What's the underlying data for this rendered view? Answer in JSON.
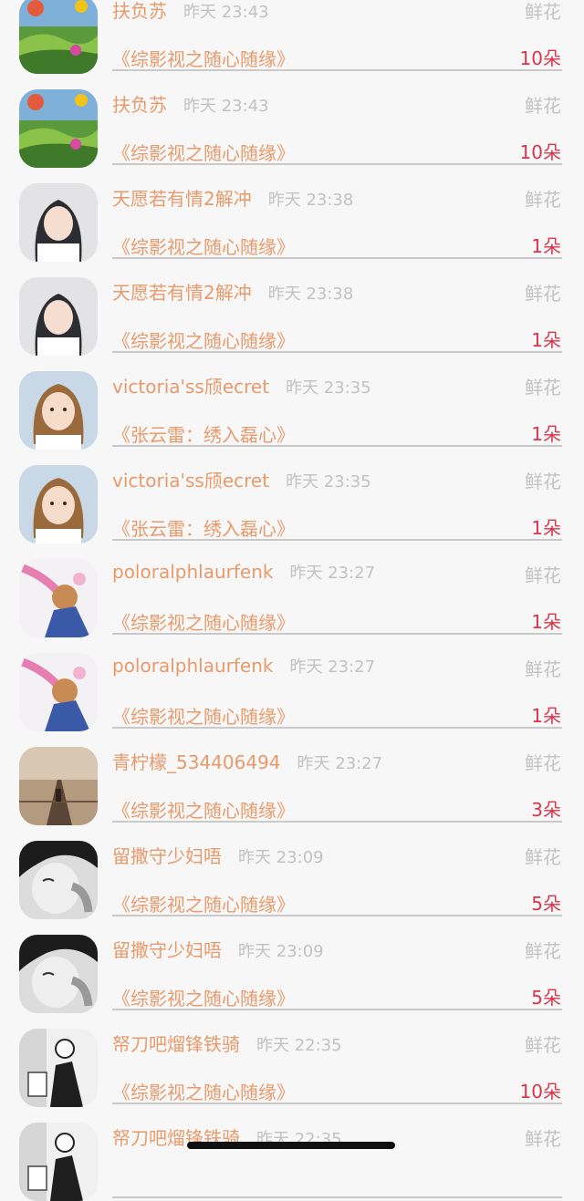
{
  "messages": [
    {
      "name": "扶负苏",
      "time": "昨天 23:43",
      "gift": "鲜花",
      "book": "《综影视之随心随缘》",
      "count": "10朵",
      "avatar": "landscape-balloon-avatar"
    },
    {
      "name": "扶负苏",
      "time": "昨天 23:43",
      "gift": "鲜花",
      "book": "《综影视之随心随缘》",
      "count": "10朵",
      "avatar": "landscape-balloon-avatar"
    },
    {
      "name": "天愿若有情2解冲",
      "time": "昨天 23:38",
      "gift": "鲜花",
      "book": "《综影视之随心随缘》",
      "count": "1朵",
      "avatar": "girl-portrait-avatar"
    },
    {
      "name": "天愿若有情2解冲",
      "time": "昨天 23:38",
      "gift": "鲜花",
      "book": "《综影视之随心随缘》",
      "count": "1朵",
      "avatar": "girl-portrait-avatar"
    },
    {
      "name": "victoria'ss颀ecret",
      "time": "昨天 23:35",
      "gift": "鲜花",
      "book": "《张云雷：绣入磊心》",
      "count": "1朵",
      "avatar": "child-portrait-avatar"
    },
    {
      "name": "victoria'ss颀ecret",
      "time": "昨天 23:35",
      "gift": "鲜花",
      "book": "《张云雷：绣入磊心》",
      "count": "1朵",
      "avatar": "child-portrait-avatar"
    },
    {
      "name": "poloralphlaurfenk",
      "time": "昨天 23:27",
      "gift": "鲜花",
      "book": "《综影视之随心随缘》",
      "count": "1朵",
      "avatar": "anime-illustration-avatar"
    },
    {
      "name": "poloralphlaurfenk",
      "time": "昨天 23:27",
      "gift": "鲜花",
      "book": "《综影视之随心随缘》",
      "count": "1朵",
      "avatar": "anime-illustration-avatar"
    },
    {
      "name": "青柠檬_534406494",
      "time": "昨天 23:27",
      "gift": "鲜花",
      "book": "《综影视之随心随缘》",
      "count": "3朵",
      "avatar": "railway-scene-avatar"
    },
    {
      "name": "留撒守少妇唔",
      "time": "昨天 23:09",
      "gift": "鲜花",
      "book": "《综影视之随心随缘》",
      "count": "5朵",
      "avatar": "crying-face-avatar"
    },
    {
      "name": "留撒守少妇唔",
      "time": "昨天 23:09",
      "gift": "鲜花",
      "book": "《综影视之随心随缘》",
      "count": "5朵",
      "avatar": "crying-face-avatar"
    },
    {
      "name": "帑刀吧熘锋铁骑",
      "time": "昨天 22:35",
      "gift": "鲜花",
      "book": "《综影视之随心随缘》",
      "count": "10朵",
      "avatar": "sketch-figure-avatar"
    },
    {
      "name": "帑刀吧熘锋铁骑",
      "time": "昨天 22:35",
      "gift": "鲜花",
      "book": "",
      "count": "",
      "avatar": "sketch-figure-avatar"
    }
  ],
  "colors": {
    "background": "#f7f7f7",
    "name_text": "#e89a6b",
    "book_text": "#e89a6b",
    "muted_text": "#c2c2c2",
    "count_text": "#d9354b",
    "divider": "#c9c9c9",
    "home_indicator": "#111111"
  }
}
